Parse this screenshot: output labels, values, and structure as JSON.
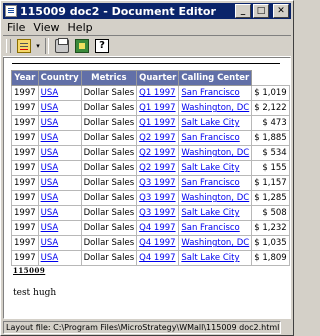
{
  "window": {
    "title": "115009 doc2 - Document Editor",
    "minimize_glyph": "_",
    "maximize_glyph": "□",
    "close_glyph": "✕"
  },
  "menu": {
    "file": "File",
    "view": "View",
    "help": "Help"
  },
  "toolbar": {
    "dropdown_caret": "▾",
    "icons": [
      "document-properties-icon",
      "print-icon",
      "export-icon",
      "help-icon"
    ],
    "help_glyph": "?"
  },
  "report": {
    "headers": [
      "Year",
      "Country",
      "Metrics",
      "Quarter",
      "Calling Center"
    ],
    "rows": [
      {
        "year": "1997",
        "country": "USA",
        "metric": "Dollar Sales",
        "quarter": "Q1 1997",
        "center": "San Francisco",
        "value": "$ 1,019"
      },
      {
        "year": "1997",
        "country": "USA",
        "metric": "Dollar Sales",
        "quarter": "Q1 1997",
        "center": "Washington, DC",
        "value": "$ 2,122"
      },
      {
        "year": "1997",
        "country": "USA",
        "metric": "Dollar Sales",
        "quarter": "Q1 1997",
        "center": "Salt Lake City",
        "value": "$ 473"
      },
      {
        "year": "1997",
        "country": "USA",
        "metric": "Dollar Sales",
        "quarter": "Q2 1997",
        "center": "San Francisco",
        "value": "$ 1,885"
      },
      {
        "year": "1997",
        "country": "USA",
        "metric": "Dollar Sales",
        "quarter": "Q2 1997",
        "center": "Washington, DC",
        "value": "$ 534"
      },
      {
        "year": "1997",
        "country": "USA",
        "metric": "Dollar Sales",
        "quarter": "Q2 1997",
        "center": "Salt Lake City",
        "value": "$ 155"
      },
      {
        "year": "1997",
        "country": "USA",
        "metric": "Dollar Sales",
        "quarter": "Q3 1997",
        "center": "San Francisco",
        "value": "$ 1,157"
      },
      {
        "year": "1997",
        "country": "USA",
        "metric": "Dollar Sales",
        "quarter": "Q3 1997",
        "center": "Washington, DC",
        "value": "$ 1,285"
      },
      {
        "year": "1997",
        "country": "USA",
        "metric": "Dollar Sales",
        "quarter": "Q3 1997",
        "center": "Salt Lake City",
        "value": "$ 508"
      },
      {
        "year": "1997",
        "country": "USA",
        "metric": "Dollar Sales",
        "quarter": "Q4 1997",
        "center": "San Francisco",
        "value": "$ 1,232"
      },
      {
        "year": "1997",
        "country": "USA",
        "metric": "Dollar Sales",
        "quarter": "Q4 1997",
        "center": "Washington, DC",
        "value": "$ 1,035"
      },
      {
        "year": "1997",
        "country": "USA",
        "metric": "Dollar Sales",
        "quarter": "Q4 1997",
        "center": "Salt Lake City",
        "value": "$ 1,809"
      }
    ]
  },
  "document": {
    "footer_title": "115009",
    "footer_text": "test hugh"
  },
  "status": {
    "text": "Layout file: C:\\Program Files\\MicroStrategy\\WMall\\115009 doc2.html"
  }
}
